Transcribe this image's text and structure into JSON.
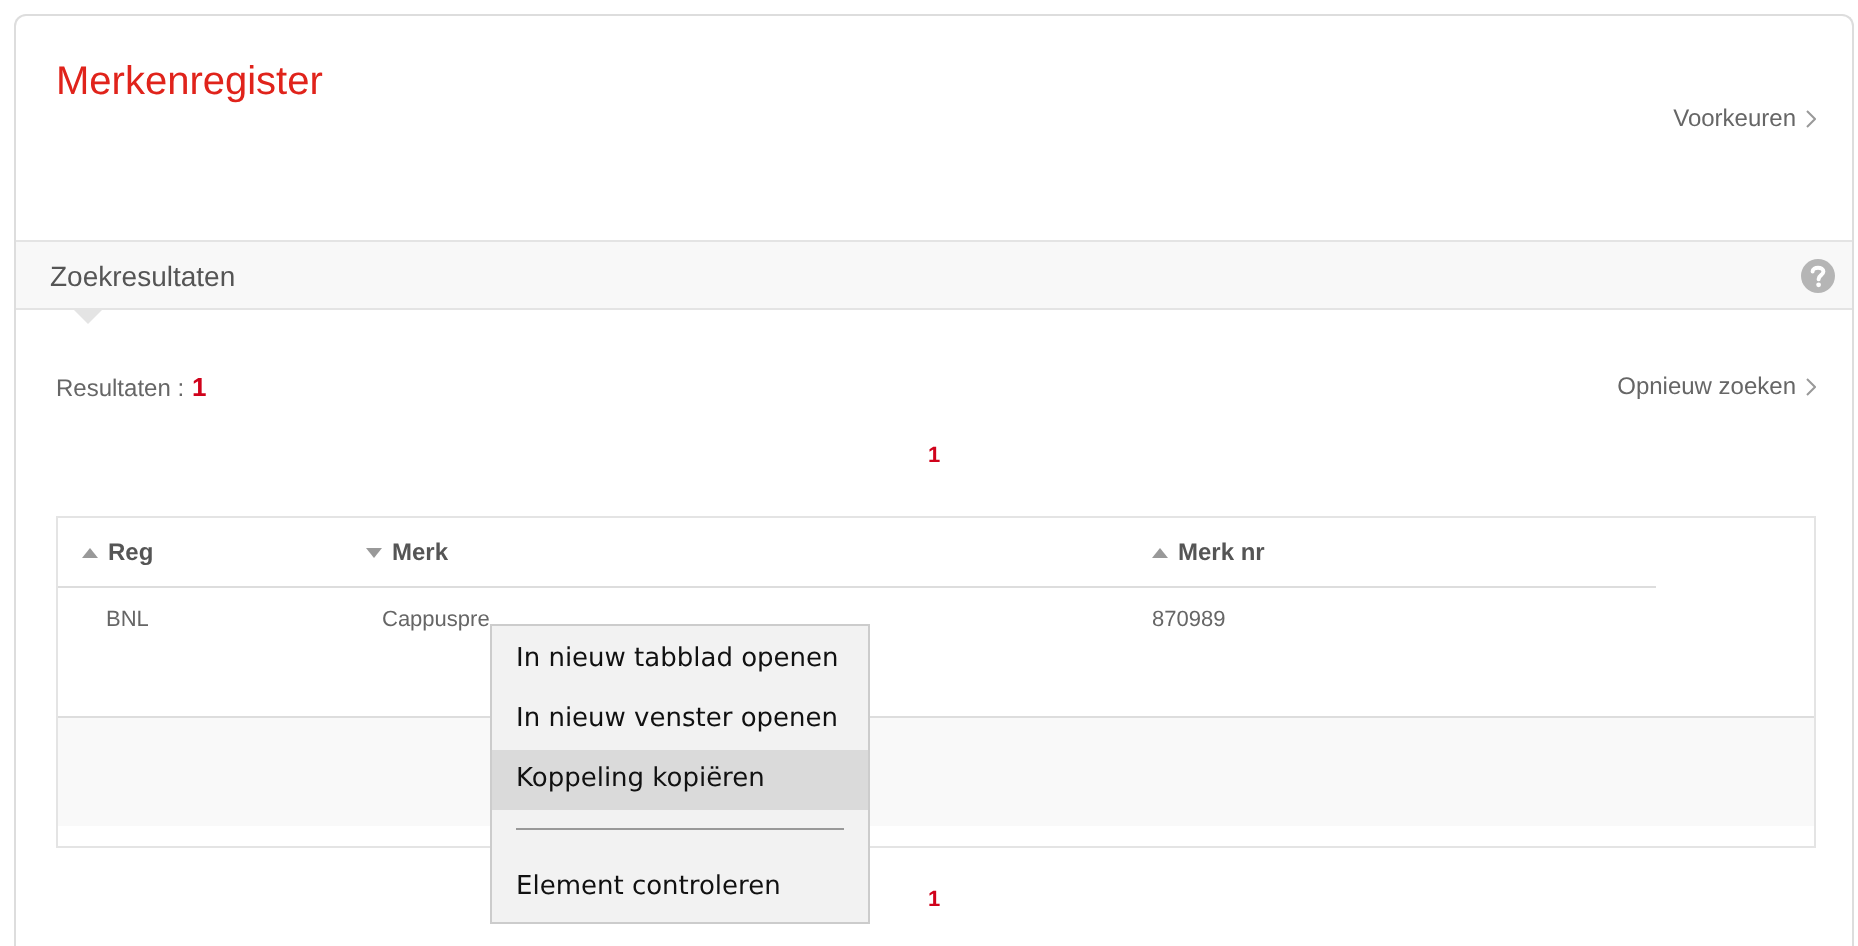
{
  "header": {
    "title": "Merkenregister",
    "preferences_link": "Voorkeuren"
  },
  "section": {
    "title": "Zoekresultaten"
  },
  "results": {
    "label": "Resultaten :",
    "count": "1",
    "new_search_link": "Opnieuw zoeken"
  },
  "pagination_top": {
    "page": "1"
  },
  "table": {
    "columns": [
      {
        "label": "Reg",
        "sorted_ascending": true
      },
      {
        "label": "Merk",
        "sorted_ascending": false
      },
      {
        "label": "Merk nr",
        "sorted_ascending": true
      }
    ],
    "rows": [
      [
        "BNL",
        "Cappuspre",
        "870989"
      ]
    ]
  },
  "pagination_bottom": {
    "page": "1"
  },
  "context_menu": {
    "items": [
      {
        "kind": "item",
        "label": "In nieuw tabblad openen",
        "selected": false
      },
      {
        "kind": "item",
        "label": "In nieuw venster openen",
        "selected": false
      },
      {
        "kind": "item",
        "label": "Koppeling kopiëren",
        "selected": true
      },
      {
        "kind": "separator"
      },
      {
        "kind": "item",
        "label": "Element controleren",
        "selected": false
      }
    ]
  }
}
